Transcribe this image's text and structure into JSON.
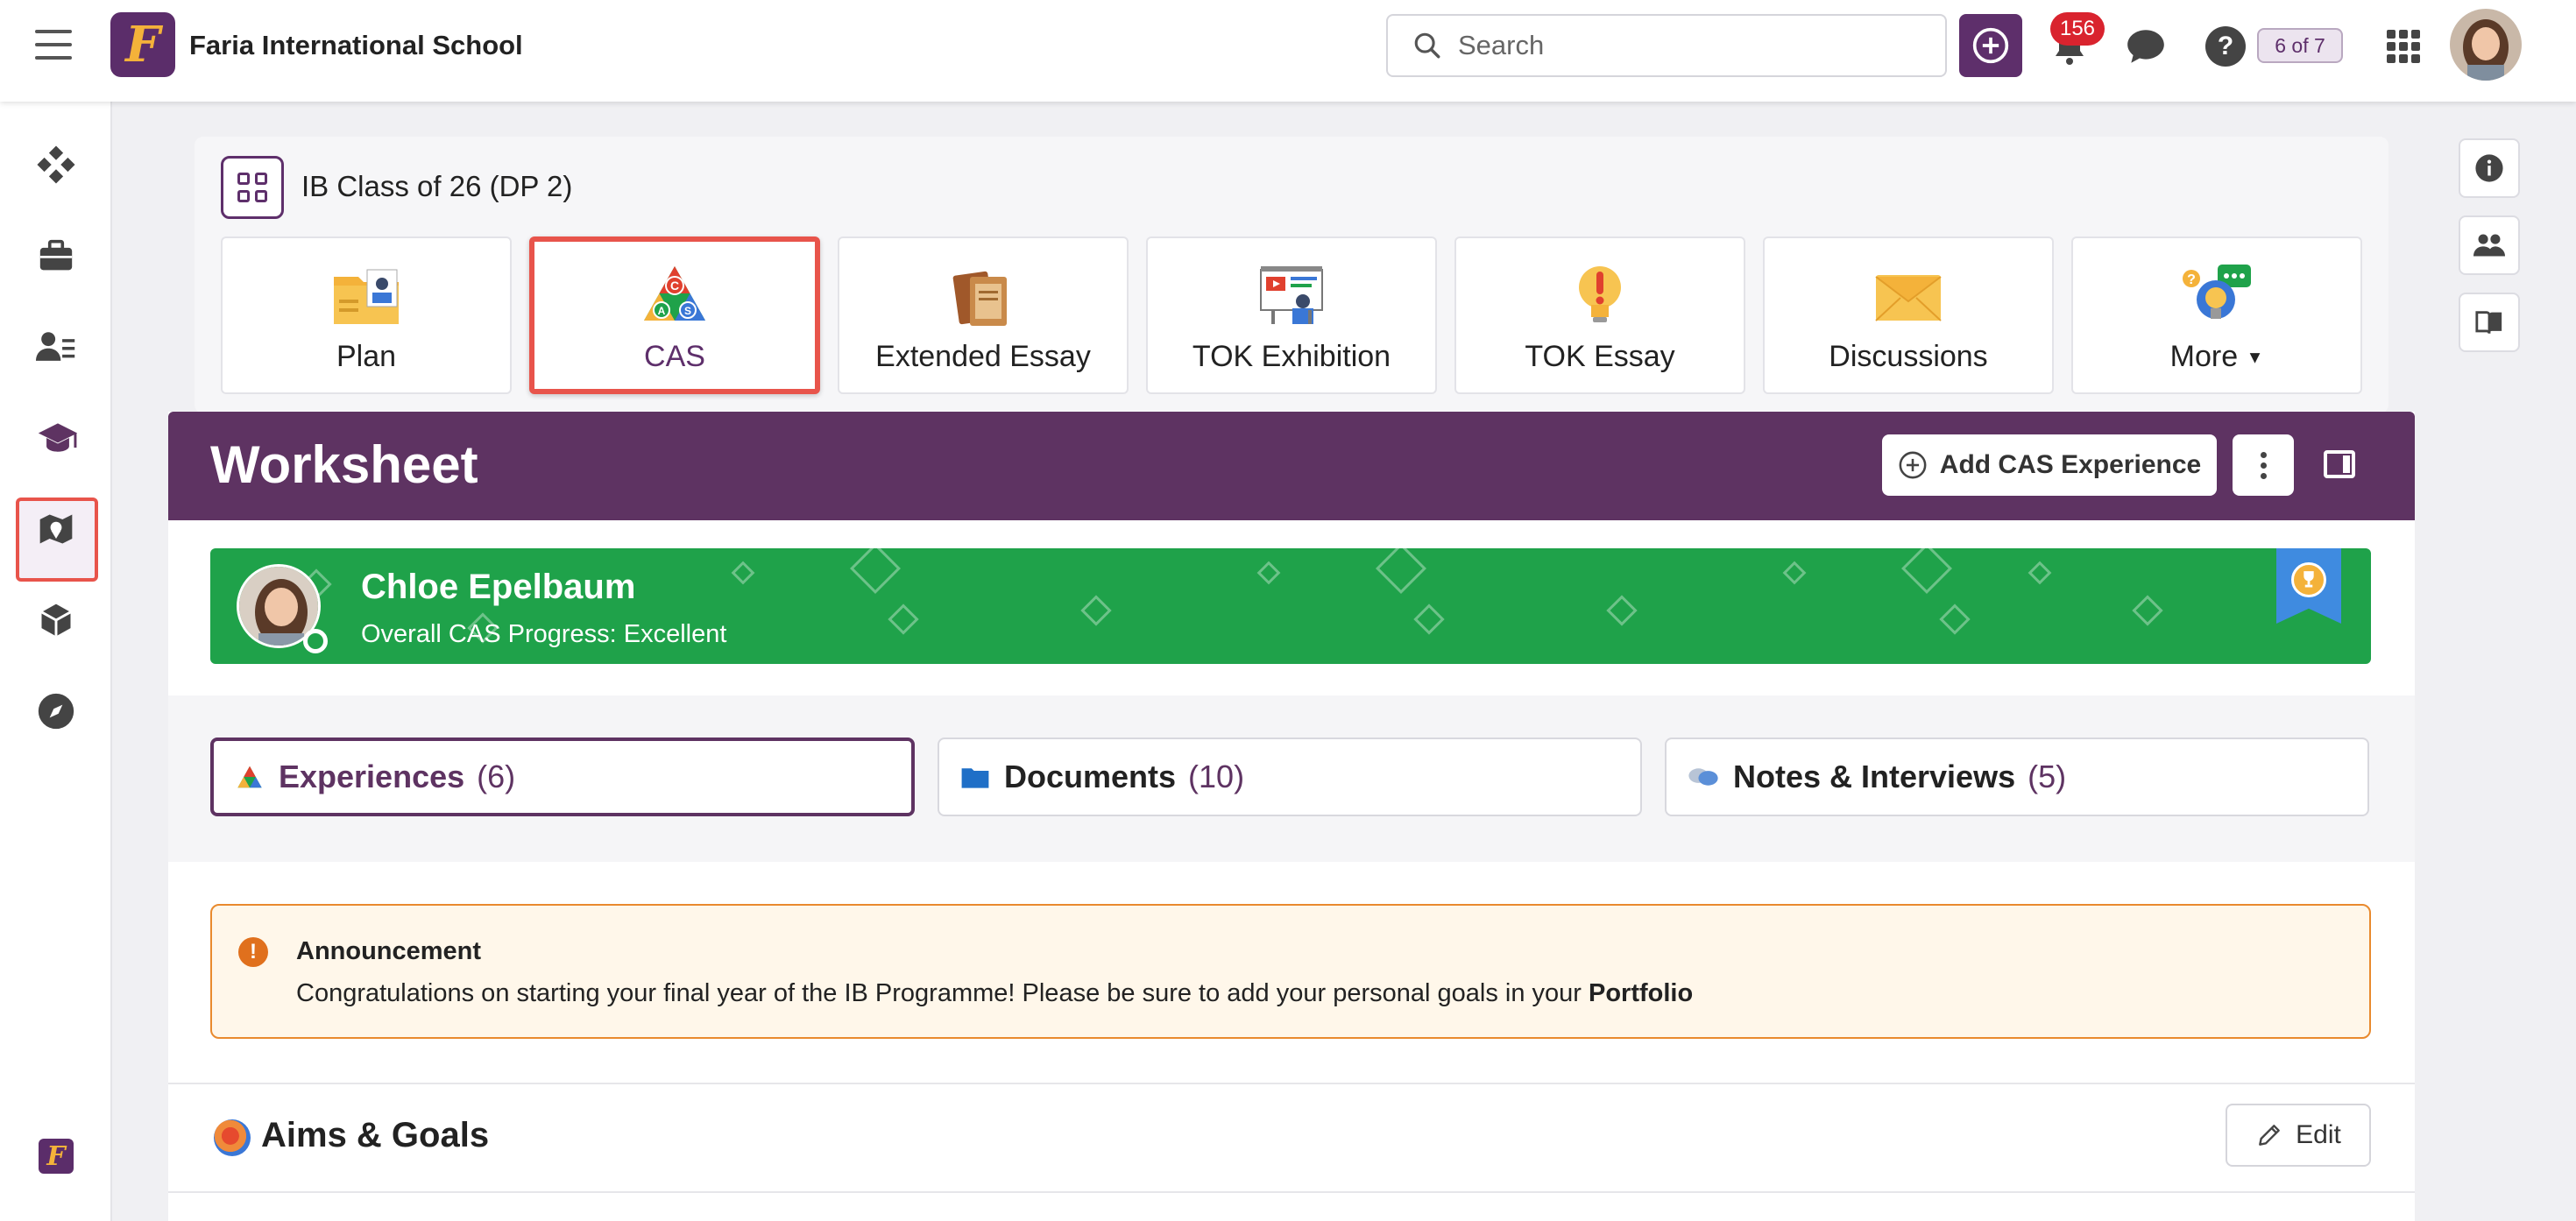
{
  "topbar": {
    "school_name": "Faria International School",
    "logo_letter": "F",
    "search_placeholder": "Search",
    "notifications_count": "156",
    "help_label": "?",
    "page_counter": "6 of 7",
    "icons": [
      "menu-icon",
      "search-icon",
      "plus-icon",
      "bell-icon",
      "chat-icon",
      "help-icon",
      "apps-grid-icon"
    ]
  },
  "left_nav": {
    "items": [
      "dashboard-icon",
      "briefcase-icon",
      "people-icon",
      "graduation-cap-icon",
      "map-icon",
      "cube-icon",
      "compass-icon"
    ],
    "active": "graduation-cap-icon",
    "bottom_logo": "F"
  },
  "right_nav": {
    "items": [
      "info-icon",
      "users-icon",
      "book-icon"
    ]
  },
  "class_header": {
    "title": "IB Class of 26 (DP 2)",
    "tiles": [
      {
        "label": "Plan",
        "icon": "plan-folder-icon"
      },
      {
        "label": "CAS",
        "icon": "cas-triangle-icon",
        "active": true
      },
      {
        "label": "Extended Essay",
        "icon": "books-icon"
      },
      {
        "label": "TOK Exhibition",
        "icon": "presentation-icon"
      },
      {
        "label": "TOK Essay",
        "icon": "lightbulb-exclamation-icon"
      },
      {
        "label": "Discussions",
        "icon": "envelope-icon"
      },
      {
        "label": "More",
        "icon": "ideas-icon"
      }
    ]
  },
  "worksheet": {
    "title": "Worksheet",
    "add_button": "Add CAS Experience",
    "student": {
      "name": "Chloe Epelbaum",
      "progress": "Overall CAS Progress: Excellent",
      "status": "online"
    },
    "tabs": [
      {
        "label": "Experiences",
        "count": "(6)",
        "active": true
      },
      {
        "label": "Documents",
        "count": "(10)"
      },
      {
        "label": "Notes & Interviews",
        "count": "(5)"
      }
    ],
    "announcement": {
      "title": "Announcement",
      "text": "Congratulations on starting your final year of the IB Programme! Please be sure to add your personal goals in your",
      "link": "Portfolio"
    },
    "aims": {
      "title": "Aims & Goals",
      "edit_label": "Edit"
    }
  },
  "colors": {
    "brand_purple": "#5e3362",
    "progress_green": "#1fa24a",
    "highlight_red": "#e8544b",
    "announcement_border": "#e98a2e"
  }
}
